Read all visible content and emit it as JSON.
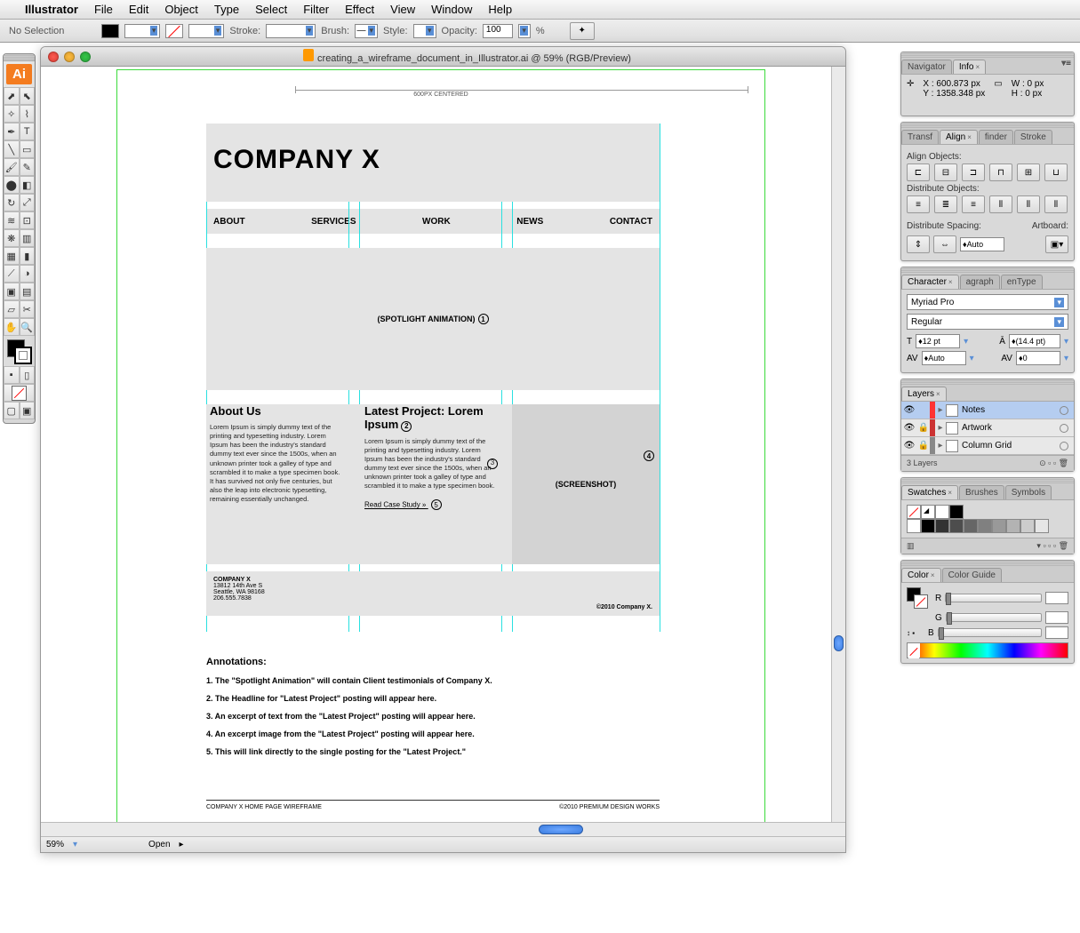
{
  "menubar": {
    "app": "Illustrator",
    "items": [
      "File",
      "Edit",
      "Object",
      "Type",
      "Select",
      "Filter",
      "Effect",
      "View",
      "Window",
      "Help"
    ]
  },
  "controlbar": {
    "selection": "No Selection",
    "stroke_label": "Stroke:",
    "brush_label": "Brush:",
    "style_label": "Style:",
    "opacity_label": "Opacity:",
    "opacity_value": "100",
    "pct": "%"
  },
  "toolbox": {
    "badge": "Ai"
  },
  "window": {
    "title": "creating_a_wireframe_document_in_Illustrator.ai @ 59% (RGB/Preview)",
    "zoom": "59%",
    "status": "Open"
  },
  "artboard": {
    "ruler_label": "600PX CENTERED",
    "company": "COMPANY X",
    "nav": [
      "ABOUT",
      "SERVICES",
      "WORK",
      "NEWS",
      "CONTACT"
    ],
    "hero": "(SPOTLIGHT ANIMATION)",
    "about_h": "About Us",
    "about_body": "Lorem Ipsum is simply dummy text of the printing and typesetting industry. Lorem Ipsum has been the industry's standard dummy text ever since the 1500s, when an unknown printer took a galley of type and scrambled it to make a type specimen book. It has survived not only five centuries, but also the leap into electronic typesetting, remaining essentially unchanged.",
    "latest_h": "Latest Project: Lorem Ipsum",
    "latest_body": "Lorem Ipsum is simply dummy text of the printing and typesetting industry. Lorem Ipsum has been the industry's standard dummy text ever since the 1500s, when an unknown printer took a galley of type and scrambled it to make a type specimen book.",
    "readmore": "Read Case Study »",
    "screenshot": "(SCREENSHOT)",
    "footer_name": "COMPANY X",
    "footer_addr1": "13812 14th Ave S",
    "footer_addr2": "Seattle, WA 98168",
    "footer_phone": "206.555.7838",
    "footer_copy": "©2010 Company X.",
    "annot_h": "Annotations:",
    "annot": [
      "1. The \"Spotlight Animation\" will contain Client testimonials of Company X.",
      "2. The Headline for \"Latest Project\" posting will appear here.",
      "3. An excerpt of text from the \"Latest Project\" posting will appear here.",
      "4. An excerpt image from the \"Latest Project\" posting will appear here.",
      "5. This will link directly to the single posting for the \"Latest Project.\""
    ],
    "pagefoot_l": "COMPANY X HOME PAGE WIREFRAME",
    "pagefoot_r": "©2010 PREMIUM DESIGN WORKS"
  },
  "panels": {
    "info": {
      "tabs": [
        "Navigator",
        "Info"
      ],
      "x_label": "X :",
      "x": "600.873 px",
      "y_label": "Y :",
      "y": "1358.348 px",
      "w_label": "W :",
      "w": "0 px",
      "h_label": "H :",
      "h": "0 px"
    },
    "align": {
      "tabs": [
        "Transf",
        "Align",
        "finder",
        "Stroke"
      ],
      "align_label": "Align Objects:",
      "dist_label": "Distribute Objects:",
      "spacing_label": "Distribute Spacing:",
      "artboard_label": "Artboard:",
      "auto": "Auto"
    },
    "char": {
      "tabs": [
        "Character",
        "agraph",
        "enType"
      ],
      "font": "Myriad Pro",
      "style": "Regular",
      "size": "12 pt",
      "leading": "(14.4 pt)",
      "kern": "Auto",
      "track": "0"
    },
    "layers": {
      "tab": "Layers",
      "rows": [
        {
          "name": "Notes",
          "color": "#ff3333"
        },
        {
          "name": "Artwork",
          "color": "#cc3333"
        },
        {
          "name": "Column Grid",
          "color": "#888888"
        }
      ],
      "count": "3 Layers"
    },
    "swatches": {
      "tabs": [
        "Swatches",
        "Brushes",
        "Symbols"
      ]
    },
    "color": {
      "tabs": [
        "Color",
        "Color Guide"
      ],
      "r": "R",
      "g": "G",
      "b": "B"
    }
  }
}
